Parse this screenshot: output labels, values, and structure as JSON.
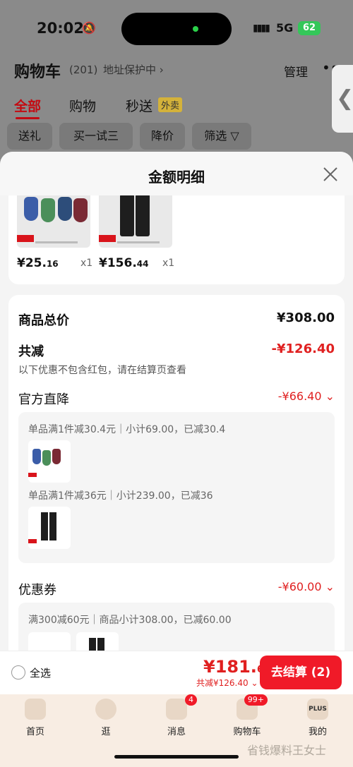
{
  "status": {
    "time": "20:02",
    "network": "5G",
    "battery": "62"
  },
  "header": {
    "title": "购物车",
    "count": "(201)",
    "address": "地址保护中 ›",
    "manage": "管理",
    "more": "•••"
  },
  "tabs": [
    {
      "label": "全部"
    },
    {
      "label": "购物"
    },
    {
      "label": "秒送"
    }
  ],
  "waimai_badge": "外卖",
  "filters": [
    "送礼",
    "买一试三",
    "降价",
    "筛选 ▽"
  ],
  "sheet": {
    "title": "金额明细",
    "items": [
      {
        "price_main": "¥25.",
        "price_dec": "16",
        "qty": "x1"
      },
      {
        "price_main": "¥156.",
        "price_dec": "44",
        "qty": "x1"
      }
    ],
    "total_label": "商品总价",
    "total_value": "¥308.00",
    "reduce_label": "共减",
    "reduce_value": "-¥126.40",
    "reduce_note": "以下优惠不包含红包，请在结算页查看",
    "official_label": "官方直降",
    "official_value": "-¥66.40 ⌄",
    "official_lines": [
      "单品满1件减30.4元｜小计69.00，已减30.4",
      "单品满1件减36元｜小计239.00，已减36"
    ],
    "coupon_label": "优惠券",
    "coupon_value": "-¥60.00 ⌄",
    "coupon_line": "满300减60元｜商品小计308.00，已减60.00"
  },
  "bottom": {
    "select_all": "全选",
    "total_main": "¥181.",
    "total_dec": "60",
    "saved": "共减¥126.40 ⌄",
    "checkout": "去结算 (2)"
  },
  "tabbar": [
    {
      "label": "首页",
      "icon": "home-icon"
    },
    {
      "label": "逛",
      "icon": "face-icon"
    },
    {
      "label": "消息",
      "icon": "message-icon",
      "badge": "4"
    },
    {
      "label": "购物车",
      "icon": "cart-icon",
      "badge": "99+"
    },
    {
      "label": "我的",
      "icon": "plus-icon",
      "icon_text": "PLUS"
    }
  ],
  "watermark": "省钱爆料王女士"
}
